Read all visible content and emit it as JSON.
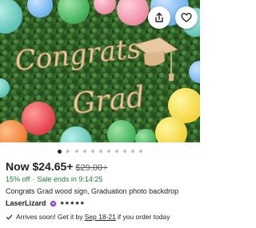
{
  "listing": {
    "image_alt": "Congrats Grad wood sign on a boxwood wall with balloons",
    "image_text": "Congrats Grad",
    "carousel": {
      "total": 11,
      "active_index": 0
    },
    "price": {
      "current": "Now $24.65+",
      "original": "$29.00+"
    },
    "discount": {
      "percent": "15% off",
      "sale_label": "Sale ends in 9:14:25",
      "separator": "·"
    },
    "title": "Congrats Grad wood sign, Graduation photo backdrop",
    "seller": {
      "name": "LaserLizard",
      "badge_icon": "star-seller-icon",
      "rating_stars": "★★★★★",
      "rating_value": 5
    },
    "shipping": {
      "prefix": "Arrives soon! Get it by",
      "date_range": "Sep 18-21",
      "suffix": "if you order today",
      "icon": "check-icon"
    }
  },
  "actions": {
    "share_icon": "share-icon",
    "favorite_icon": "heart-icon"
  },
  "colors": {
    "sale_green": "#1f7a3a",
    "text": "#222222",
    "muted": "#595959",
    "seller_badge": "#7e3bdb"
  }
}
